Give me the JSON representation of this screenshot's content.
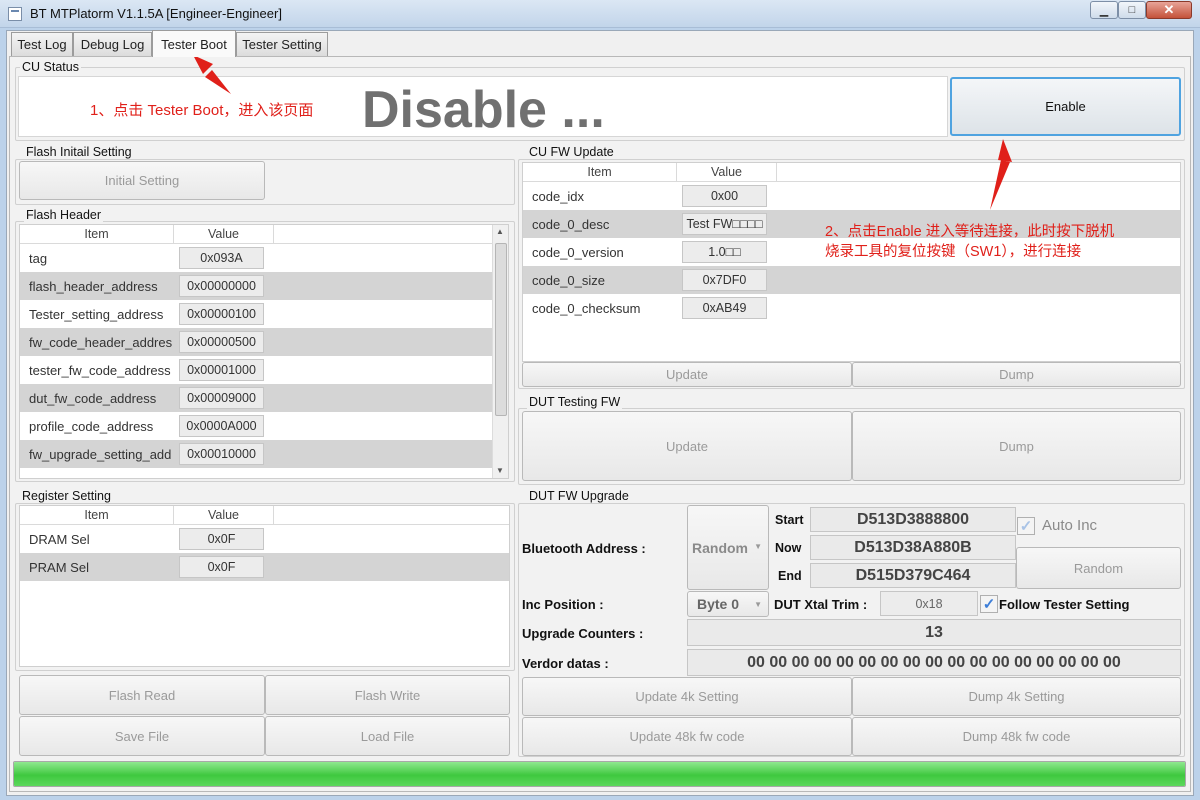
{
  "window": {
    "title": "BT MTPlatorm V1.1.5A [Engineer-Engineer]",
    "min_glyph": "▁",
    "max_glyph": "□",
    "close_glyph": "✕"
  },
  "tabs": [
    {
      "label": "Test Log"
    },
    {
      "label": "Debug Log"
    },
    {
      "label": "Tester Boot"
    },
    {
      "label": "Tester Setting"
    }
  ],
  "cu_status": {
    "title": "CU Status",
    "state_text": "Disable ...",
    "enable_label": "Enable"
  },
  "annotations": {
    "step1": "1、点击 Tester Boot，进入该页面",
    "step2_line1": "2、点击Enable 进入等待连接，此时按下脱机",
    "step2_line2": "烧录工具的复位按键（SW1），进行连接",
    "arrow_color": "#e0201a"
  },
  "flash_initial": {
    "title": "Flash Initail Setting",
    "button": "Initial Setting"
  },
  "flash_header": {
    "title": "Flash Header",
    "col_item": "Item",
    "col_value": "Value",
    "rows": [
      {
        "item": "tag",
        "value": "0x093A"
      },
      {
        "item": "flash_header_address",
        "value": "0x00000000"
      },
      {
        "item": "Tester_setting_address",
        "value": "0x00000100"
      },
      {
        "item": "fw_code_header_address",
        "value": "0x00000500"
      },
      {
        "item": "tester_fw_code_address",
        "value": "0x00001000"
      },
      {
        "item": "dut_fw_code_address",
        "value": "0x00009000"
      },
      {
        "item": "profile_code_address",
        "value": "0x0000A000"
      },
      {
        "item": "fw_upgrade_setting_address",
        "value": "0x00010000"
      }
    ]
  },
  "register_setting": {
    "title": "Register Setting",
    "col_item": "Item",
    "col_value": "Value",
    "rows": [
      {
        "item": "DRAM Sel",
        "value": "0x0F"
      },
      {
        "item": "PRAM Sel",
        "value": "0x0F"
      }
    ]
  },
  "left_buttons": {
    "flash_read": "Flash Read",
    "flash_write": "Flash Write",
    "save_file": "Save File",
    "load_file": "Load File"
  },
  "cu_fw_update": {
    "title": "CU FW Update",
    "col_item": "Item",
    "col_value": "Value",
    "rows": [
      {
        "item": "code_idx",
        "value": "0x00"
      },
      {
        "item": "code_0_desc",
        "value": "Test FW□□□□"
      },
      {
        "item": "code_0_version",
        "value": "1.0□□"
      },
      {
        "item": "code_0_size",
        "value": "0x7DF0"
      },
      {
        "item": "code_0_checksum",
        "value": "0xAB49"
      }
    ],
    "update": "Update",
    "dump": "Dump"
  },
  "dut_testing_fw": {
    "title": "DUT Testing FW",
    "update": "Update",
    "dump": "Dump"
  },
  "dut_fw_upgrade": {
    "title": "DUT FW Upgrade",
    "bt_address_label": "Bluetooth Address :",
    "mode_select": "Random",
    "start_label": "Start",
    "start_value": "D513D3888800",
    "now_label": "Now",
    "now_value": "D513D38A880B",
    "end_label": "End",
    "end_value": "D515D379C464",
    "auto_inc_label": "Auto Inc",
    "random_button": "Random",
    "inc_position_label": "Inc Position :",
    "inc_position_value": "Byte 0",
    "xtal_trim_label": "DUT Xtal Trim :",
    "xtal_trim_value": "0x18",
    "follow_tester_label": "Follow Tester Setting",
    "upgrade_counters_label": "Upgrade Counters :",
    "upgrade_counters_value": "13",
    "vendor_datas_label": "Verdor datas :",
    "vendor_datas_value": "00 00 00 00 00 00 00 00 00 00 00 00 00 00 00 00 00",
    "update_4k": "Update 4k Setting",
    "dump_4k": "Dump 4k Setting",
    "update_48k": "Update 48k fw code",
    "dump_48k": "Dump 48k fw code"
  },
  "progress": {
    "fraction": 1.0,
    "color": "#3fc83f"
  }
}
